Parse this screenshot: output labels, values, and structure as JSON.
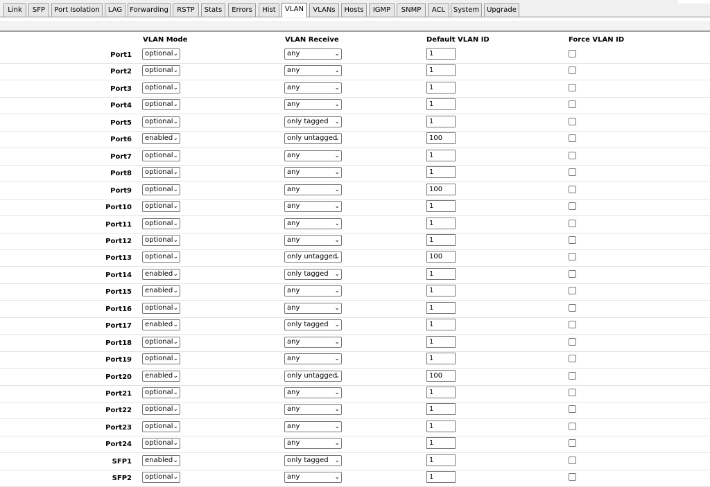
{
  "tabs": [
    {
      "label": "Link",
      "active": false
    },
    {
      "label": "SFP",
      "active": false
    },
    {
      "label": "Port Isolation",
      "active": false
    },
    {
      "label": "LAG",
      "active": false
    },
    {
      "label": "Forwarding",
      "active": false
    },
    {
      "label": "RSTP",
      "active": false
    },
    {
      "label": "Stats",
      "active": false
    },
    {
      "label": "Errors",
      "active": false
    },
    {
      "label": "Hist",
      "active": false
    },
    {
      "label": "VLAN",
      "active": true
    },
    {
      "label": "VLANs",
      "active": false
    },
    {
      "label": "Hosts",
      "active": false
    },
    {
      "label": "IGMP",
      "active": false
    },
    {
      "label": "SNMP",
      "active": false
    },
    {
      "label": "ACL",
      "active": false
    },
    {
      "label": "System",
      "active": false
    },
    {
      "label": "Upgrade",
      "active": false
    }
  ],
  "table": {
    "headers": {
      "vlan_mode": "VLAN Mode",
      "vlan_receive": "VLAN Receive",
      "default_vlan_id": "Default VLAN ID",
      "force_vlan_id": "Force VLAN ID"
    },
    "rows": [
      {
        "port": "Port1",
        "mode": "optional",
        "receive": "any",
        "vlan_id": "1",
        "force": false
      },
      {
        "port": "Port2",
        "mode": "optional",
        "receive": "any",
        "vlan_id": "1",
        "force": false
      },
      {
        "port": "Port3",
        "mode": "optional",
        "receive": "any",
        "vlan_id": "1",
        "force": false
      },
      {
        "port": "Port4",
        "mode": "optional",
        "receive": "any",
        "vlan_id": "1",
        "force": false
      },
      {
        "port": "Port5",
        "mode": "optional",
        "receive": "only tagged",
        "vlan_id": "1",
        "force": false
      },
      {
        "port": "Port6",
        "mode": "enabled",
        "receive": "only untagged",
        "vlan_id": "100",
        "force": false
      },
      {
        "port": "Port7",
        "mode": "optional",
        "receive": "any",
        "vlan_id": "1",
        "force": false
      },
      {
        "port": "Port8",
        "mode": "optional",
        "receive": "any",
        "vlan_id": "1",
        "force": false
      },
      {
        "port": "Port9",
        "mode": "optional",
        "receive": "any",
        "vlan_id": "100",
        "force": false
      },
      {
        "port": "Port10",
        "mode": "optional",
        "receive": "any",
        "vlan_id": "1",
        "force": false
      },
      {
        "port": "Port11",
        "mode": "optional",
        "receive": "any",
        "vlan_id": "1",
        "force": false
      },
      {
        "port": "Port12",
        "mode": "optional",
        "receive": "any",
        "vlan_id": "1",
        "force": false
      },
      {
        "port": "Port13",
        "mode": "optional",
        "receive": "only untagged",
        "vlan_id": "100",
        "force": false
      },
      {
        "port": "Port14",
        "mode": "enabled",
        "receive": "only tagged",
        "vlan_id": "1",
        "force": false
      },
      {
        "port": "Port15",
        "mode": "enabled",
        "receive": "any",
        "vlan_id": "1",
        "force": false
      },
      {
        "port": "Port16",
        "mode": "optional",
        "receive": "any",
        "vlan_id": "1",
        "force": false
      },
      {
        "port": "Port17",
        "mode": "enabled",
        "receive": "only tagged",
        "vlan_id": "1",
        "force": false
      },
      {
        "port": "Port18",
        "mode": "optional",
        "receive": "any",
        "vlan_id": "1",
        "force": false
      },
      {
        "port": "Port19",
        "mode": "optional",
        "receive": "any",
        "vlan_id": "1",
        "force": false
      },
      {
        "port": "Port20",
        "mode": "enabled",
        "receive": "only untagged",
        "vlan_id": "100",
        "force": false
      },
      {
        "port": "Port21",
        "mode": "optional",
        "receive": "any",
        "vlan_id": "1",
        "force": false
      },
      {
        "port": "Port22",
        "mode": "optional",
        "receive": "any",
        "vlan_id": "1",
        "force": false
      },
      {
        "port": "Port23",
        "mode": "optional",
        "receive": "any",
        "vlan_id": "1",
        "force": false
      },
      {
        "port": "Port24",
        "mode": "optional",
        "receive": "any",
        "vlan_id": "1",
        "force": false
      },
      {
        "port": "SFP1",
        "mode": "enabled",
        "receive": "only tagged",
        "vlan_id": "1",
        "force": false
      },
      {
        "port": "SFP2",
        "mode": "optional",
        "receive": "any",
        "vlan_id": "1",
        "force": false
      }
    ]
  }
}
